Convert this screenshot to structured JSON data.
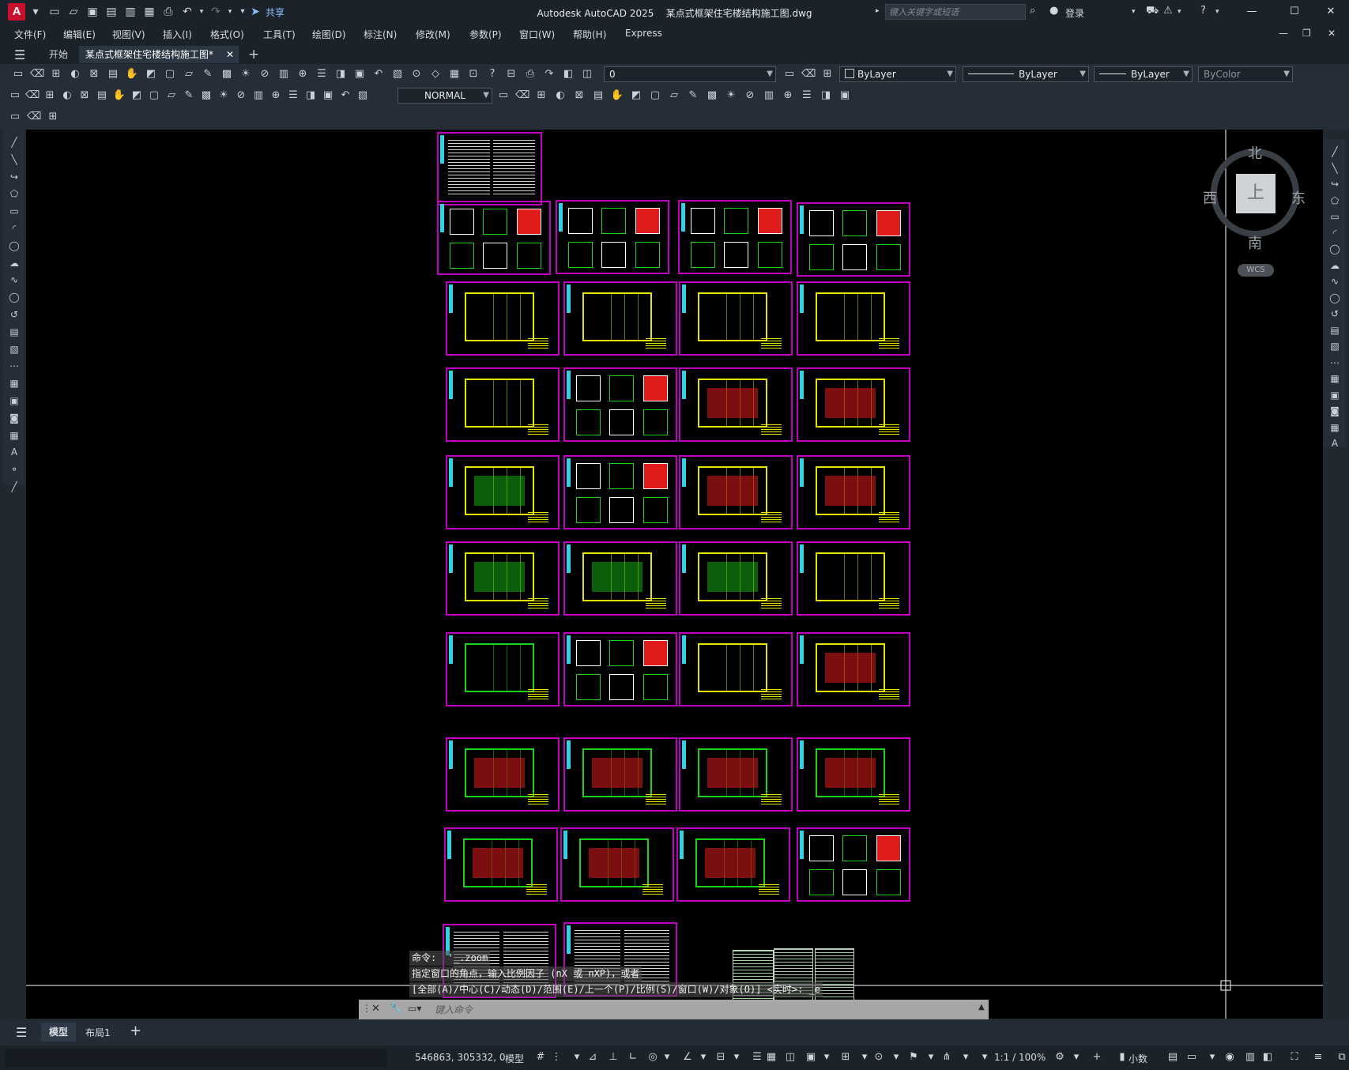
{
  "titlebar": {
    "logo_letter": "A",
    "share": "共享",
    "app_name": "Autodesk AutoCAD 2025",
    "file_name": "某点式框架住宅楼结构施工图.dwg",
    "search_placeholder": "键入关键字或短语",
    "login": "登录"
  },
  "menubar": [
    "文件(F)",
    "编辑(E)",
    "视图(V)",
    "插入(I)",
    "格式(O)",
    "工具(T)",
    "绘图(D)",
    "标注(N)",
    "修改(M)",
    "参数(P)",
    "窗口(W)",
    "帮助(H)",
    "Express"
  ],
  "tabs": {
    "start": "开始",
    "active": "某点式框架住宅楼结构施工图*",
    "add": "+"
  },
  "properties": {
    "layer": "0",
    "color": "ByLayer",
    "linetype": "ByLayer",
    "lineweight": "ByLayer",
    "plotstyle": "ByColor",
    "dimstyle": "NORMAL"
  },
  "viewcube": {
    "north": "北",
    "south": "南",
    "east": "东",
    "west": "西",
    "face": "上",
    "wcs": "WCS"
  },
  "command": {
    "history": [
      "命令:  '_.zoom",
      "指定窗口的角点，输入比例因子 (nX 或 nXP)，或者",
      "[全部(A)/中心(C)/动态(D)/范围(E)/上一个(P)/比例(S)/窗口(W)/对象(O)] <实时>: _e"
    ],
    "placeholder": "键入命令"
  },
  "layout_tabs": [
    "模型",
    "布局1"
  ],
  "status": {
    "coords": "546863, 305332, 0",
    "model": "模型",
    "scale": "1:1 / 100%",
    "units": "小数"
  },
  "colors": {
    "sheet_border": "#c000c0",
    "plan_yellow": "#e6e600",
    "plan_green": "#19d219",
    "plan_red": "#e01b1b",
    "strip_cyan": "#2fd3e8"
  }
}
